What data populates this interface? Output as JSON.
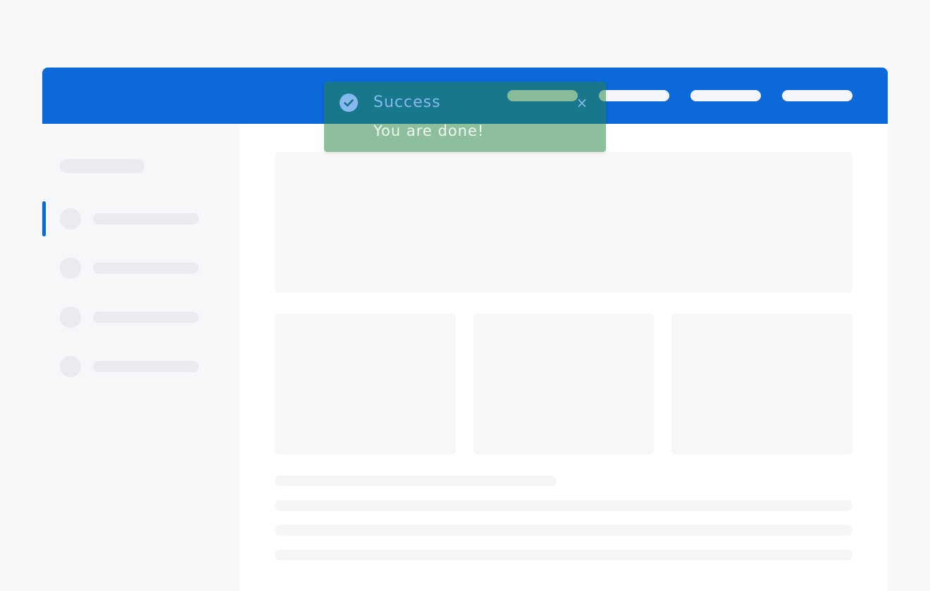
{
  "colors": {
    "accent": "#0b69da",
    "page_background": "#f6f7f9",
    "skeleton": "#e9ebf1",
    "toast_background": "#248541",
    "toast_title": "#86b9ee",
    "toast_message": "#eef6f0"
  },
  "toast": {
    "status": "success",
    "icon": "check-circle-icon",
    "title": "Success",
    "message": "You are done!",
    "close_label": "×"
  }
}
